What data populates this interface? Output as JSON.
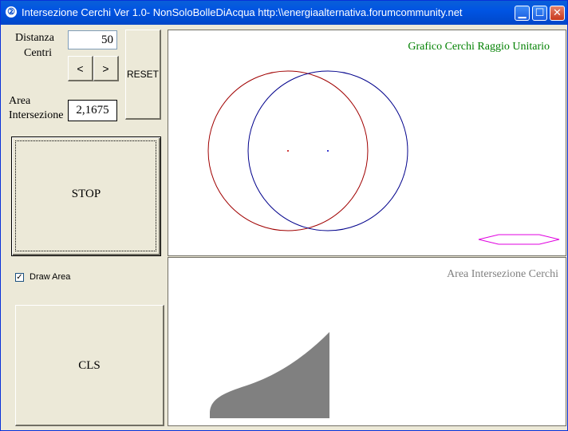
{
  "window": {
    "title": "Intersezione Cerchi Ver 1.0- NonSoloBolleDiAcqua http:\\\\energiaalternativa.forumcommunity.net",
    "app_icon": "circle-2-icon"
  },
  "titlebar_buttons": {
    "minimize": "minimize-icon",
    "maximize": "maximize-icon",
    "close": "close-icon"
  },
  "controls": {
    "distance_label_line1": "Distanza",
    "distance_label_line2": "Centri",
    "distance_value": "50",
    "decrement_label": "<",
    "increment_label": ">",
    "reset_label": "RESET",
    "area_label_line1": "Area",
    "area_label_line2": "Intersezione",
    "area_value": "2,1675",
    "stop_label": "STOP",
    "draw_area_label": "Draw Area",
    "draw_area_checked": true,
    "cls_label": "CLS"
  },
  "circles_plot": {
    "title": "Grafico Cerchi Raggio Unitario",
    "title_color": "#008000",
    "circle1_color": "#A00000",
    "circle2_color": "#00008B",
    "arrow_color": "#E000E0",
    "arrow_icon": "double-arrow-icon"
  },
  "area_plot": {
    "title": "Area Intersezione Cerchi",
    "title_color": "#808080",
    "fill_color": "#808080"
  }
}
